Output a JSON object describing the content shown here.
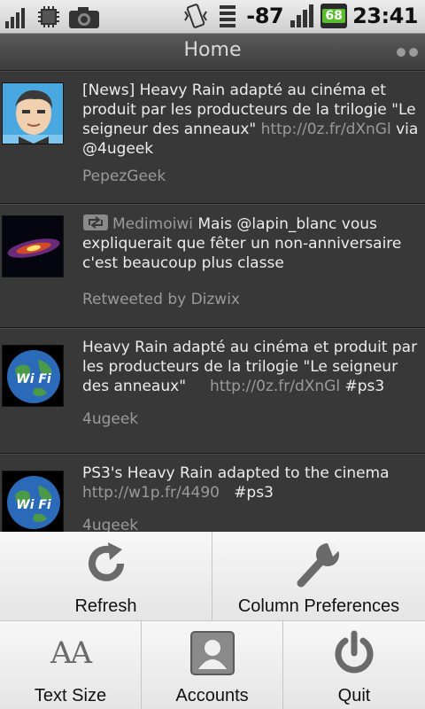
{
  "status_bar": {
    "icons_left": [
      "signal-bars-icon",
      "chip-icon",
      "camera-icon"
    ],
    "icons_right": [
      "vibrate-icon",
      "wifi-icon"
    ],
    "signal_strength": "-87",
    "battery": "68",
    "time": "23:41"
  },
  "header": {
    "title": "Home"
  },
  "tweets": [
    {
      "text": "[News] Heavy Rain adapté au cinéma et produit par les producteurs de la trilogie \"Le seigneur des anneaux\"",
      "link": "http://0z.fr/dXnGl",
      "suffix": " via @4ugeek",
      "author": "PepezGeek"
    },
    {
      "user": "Medimoiwi",
      "text": " Mais @lapin_blanc vous expliquerait que fêter un non-anniversaire c'est beaucoup plus classe",
      "retweet_label": "Retweeted by Dizwix"
    },
    {
      "text": "Heavy Rain adapté au cinéma et produit par les producteurs de la trilogie \"Le seigneur des anneaux\"",
      "link": "http://0z.fr/dXnGl",
      "hashtag": "#ps3",
      "author": "4ugeek"
    },
    {
      "text": "PS3's Heavy Rain adapted to the cinema",
      "link": "http://w1p.fr/4490",
      "hashtag": "#ps3",
      "author": "4ugeek"
    }
  ],
  "menu": {
    "refresh": "Refresh",
    "column_preferences": "Column Preferences",
    "text_size": "Text Size",
    "text_size_glyph": "AA",
    "accounts": "Accounts",
    "quit": "Quit"
  }
}
